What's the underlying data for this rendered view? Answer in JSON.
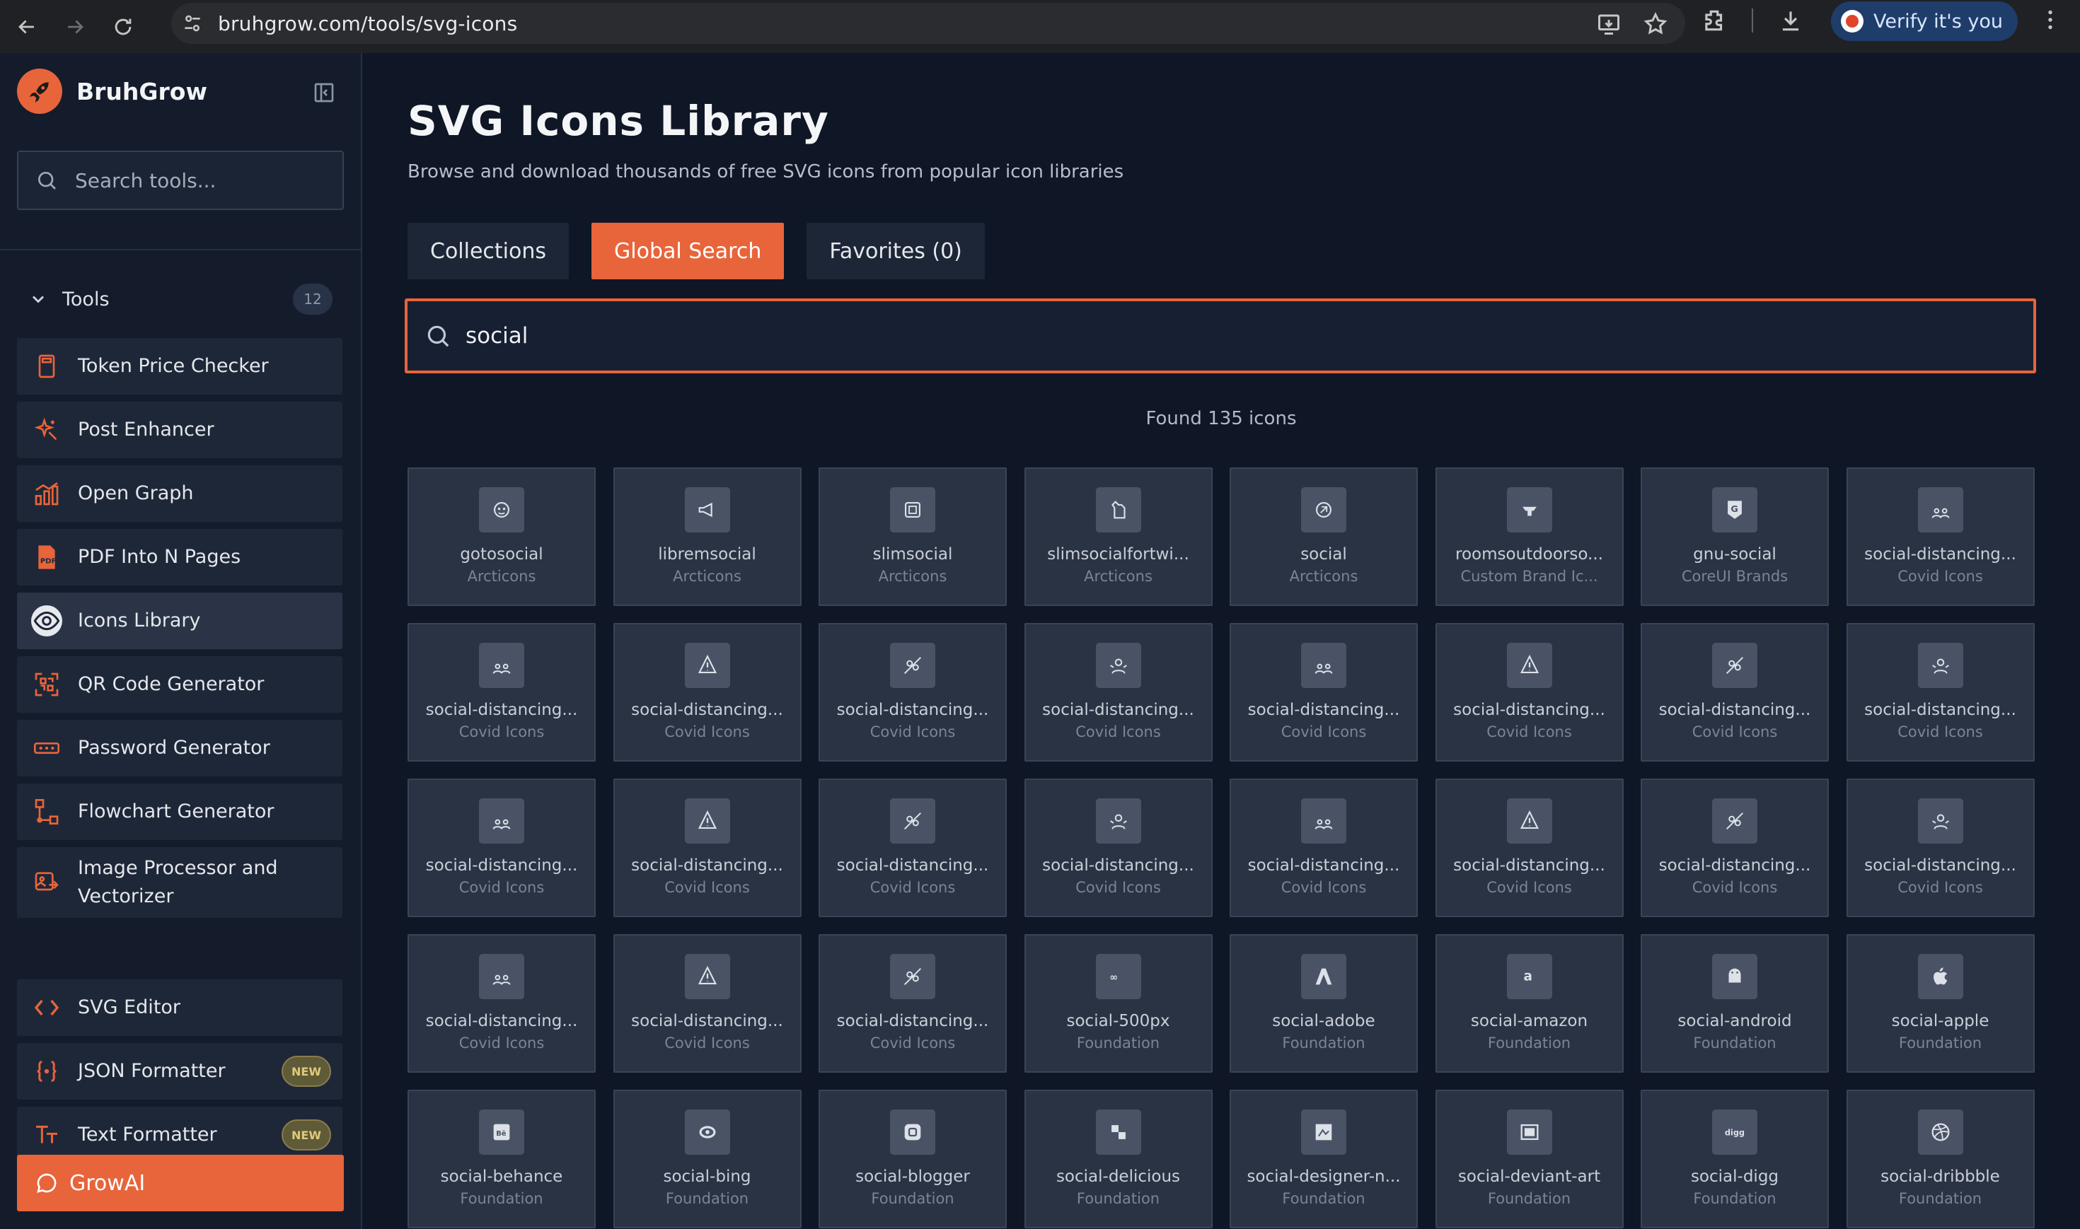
{
  "browser": {
    "url": "bruhgrow.com/tools/svg-icons",
    "verify_label": "Verify it's you"
  },
  "sidebar": {
    "brand": "BruhGrow",
    "search_placeholder": "Search tools...",
    "tools_label": "Tools",
    "tools_count": "12",
    "items": [
      {
        "label": "Token Price Checker",
        "icon": "calculator-icon"
      },
      {
        "label": "Post Enhancer",
        "icon": "sparkle-icon"
      },
      {
        "label": "Open Graph",
        "icon": "bar-chart-icon"
      },
      {
        "label": "PDF Into N Pages",
        "icon": "pdf-icon"
      },
      {
        "label": "Icons Library",
        "icon": "eye-icon",
        "active": true
      },
      {
        "label": "QR Code Generator",
        "icon": "qr-code-icon"
      },
      {
        "label": "Password Generator",
        "icon": "password-icon"
      },
      {
        "label": "Flowchart Generator",
        "icon": "flowchart-icon"
      },
      {
        "label": "Image Processor and Vectorizer",
        "icon": "image-icon"
      },
      {
        "label": "SVG Editor",
        "icon": "code-icon"
      },
      {
        "label": "JSON Formatter",
        "icon": "braces-icon",
        "badge": "NEW"
      },
      {
        "label": "Text Formatter",
        "icon": "text-format-icon",
        "badge": "NEW"
      }
    ],
    "growai_label": "GrowAI"
  },
  "main": {
    "title": "SVG Icons Library",
    "subtitle": "Browse and download thousands of free SVG icons from popular icon libraries",
    "tabs": [
      "Collections",
      "Global Search",
      "Favorites (0)"
    ],
    "active_tab": "Global Search",
    "search_value": "social",
    "found_text": "Found 135 icons",
    "accent_color": "#e8643a",
    "icons": [
      {
        "name": "gotosocial",
        "collection": "Arcticons"
      },
      {
        "name": "libremsocial",
        "collection": "Arcticons"
      },
      {
        "name": "slimsocial",
        "collection": "Arcticons"
      },
      {
        "name": "slimsocialfortwi...",
        "collection": "Arcticons"
      },
      {
        "name": "social",
        "collection": "Arcticons"
      },
      {
        "name": "roomsoutdoorso...",
        "collection": "Custom Brand Ic..."
      },
      {
        "name": "gnu-social",
        "collection": "CoreUI Brands"
      },
      {
        "name": "social-distancing...",
        "collection": "Covid Icons"
      },
      {
        "name": "social-distancing...",
        "collection": "Covid Icons"
      },
      {
        "name": "social-distancing...",
        "collection": "Covid Icons"
      },
      {
        "name": "social-distancing...",
        "collection": "Covid Icons"
      },
      {
        "name": "social-distancing...",
        "collection": "Covid Icons"
      },
      {
        "name": "social-distancing...",
        "collection": "Covid Icons"
      },
      {
        "name": "social-distancing...",
        "collection": "Covid Icons"
      },
      {
        "name": "social-distancing...",
        "collection": "Covid Icons"
      },
      {
        "name": "social-distancing...",
        "collection": "Covid Icons"
      },
      {
        "name": "social-distancing...",
        "collection": "Covid Icons"
      },
      {
        "name": "social-distancing...",
        "collection": "Covid Icons"
      },
      {
        "name": "social-distancing...",
        "collection": "Covid Icons"
      },
      {
        "name": "social-distancing...",
        "collection": "Covid Icons"
      },
      {
        "name": "social-distancing...",
        "collection": "Covid Icons"
      },
      {
        "name": "social-distancing...",
        "collection": "Covid Icons"
      },
      {
        "name": "social-distancing...",
        "collection": "Covid Icons"
      },
      {
        "name": "social-distancing...",
        "collection": "Covid Icons"
      },
      {
        "name": "social-distancing...",
        "collection": "Covid Icons"
      },
      {
        "name": "social-distancing...",
        "collection": "Covid Icons"
      },
      {
        "name": "social-distancing...",
        "collection": "Covid Icons"
      },
      {
        "name": "social-500px",
        "collection": "Foundation"
      },
      {
        "name": "social-adobe",
        "collection": "Foundation"
      },
      {
        "name": "social-amazon",
        "collection": "Foundation"
      },
      {
        "name": "social-android",
        "collection": "Foundation"
      },
      {
        "name": "social-apple",
        "collection": "Foundation"
      },
      {
        "name": "social-behance",
        "collection": "Foundation"
      },
      {
        "name": "social-bing",
        "collection": "Foundation"
      },
      {
        "name": "social-blogger",
        "collection": "Foundation"
      },
      {
        "name": "social-delicious",
        "collection": "Foundation"
      },
      {
        "name": "social-designer-n...",
        "collection": "Foundation"
      },
      {
        "name": "social-deviant-art",
        "collection": "Foundation"
      },
      {
        "name": "social-digg",
        "collection": "Foundation"
      },
      {
        "name": "social-dribbble",
        "collection": "Foundation"
      }
    ]
  }
}
